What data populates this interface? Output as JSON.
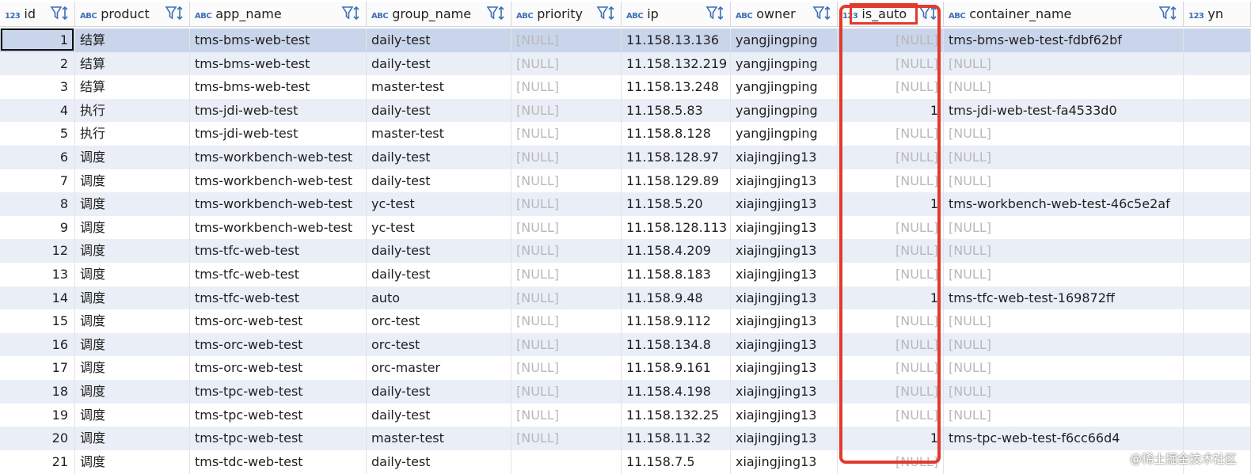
{
  "columns": [
    {
      "type": "123",
      "name": "id"
    },
    {
      "type": "ABC",
      "name": "product"
    },
    {
      "type": "ABC",
      "name": "app_name"
    },
    {
      "type": "ABC",
      "name": "group_name"
    },
    {
      "type": "ABC",
      "name": "priority"
    },
    {
      "type": "ABC",
      "name": "ip"
    },
    {
      "type": "ABC",
      "name": "owner"
    },
    {
      "type": "123",
      "name": "is_auto"
    },
    {
      "type": "ABC",
      "name": "container_name"
    },
    {
      "type": "123",
      "name": "yn"
    }
  ],
  "rows": [
    [
      "1",
      "结算",
      "tms-bms-web-test",
      "daily-test",
      "[NULL]",
      "11.158.13.136",
      "yangjingping",
      "[NULL]",
      "tms-bms-web-test-fdbf62bf"
    ],
    [
      "2",
      "结算",
      "tms-bms-web-test",
      "daily-test",
      "[NULL]",
      "11.158.132.219",
      "yangjingping",
      "[NULL]",
      "[NULL]"
    ],
    [
      "3",
      "结算",
      "tms-bms-web-test",
      "master-test",
      "[NULL]",
      "11.158.13.248",
      "yangjingping",
      "[NULL]",
      "[NULL]"
    ],
    [
      "4",
      "执行",
      "tms-jdi-web-test",
      "daily-test",
      "[NULL]",
      "11.158.5.83",
      "yangjingping",
      "1",
      "tms-jdi-web-test-fa4533d0"
    ],
    [
      "5",
      "执行",
      "tms-jdi-web-test",
      "master-test",
      "[NULL]",
      "11.158.8.128",
      "yangjingping",
      "[NULL]",
      "[NULL]"
    ],
    [
      "6",
      "调度",
      "tms-workbench-web-test",
      "daily-test",
      "[NULL]",
      "11.158.128.97",
      "xiajingjing13",
      "[NULL]",
      "[NULL]"
    ],
    [
      "7",
      "调度",
      "tms-workbench-web-test",
      "daily-test",
      "[NULL]",
      "11.158.129.89",
      "xiajingjing13",
      "[NULL]",
      "[NULL]"
    ],
    [
      "8",
      "调度",
      "tms-workbench-web-test",
      "yc-test",
      "[NULL]",
      "11.158.5.20",
      "xiajingjing13",
      "1",
      "tms-workbench-web-test-46c5e2af"
    ],
    [
      "9",
      "调度",
      "tms-workbench-web-test",
      "yc-test",
      "[NULL]",
      "11.158.128.113",
      "xiajingjing13",
      "[NULL]",
      "[NULL]"
    ],
    [
      "12",
      "调度",
      "tms-tfc-web-test",
      "daily-test",
      "[NULL]",
      "11.158.4.209",
      "xiajingjing13",
      "[NULL]",
      "[NULL]"
    ],
    [
      "13",
      "调度",
      "tms-tfc-web-test",
      "daily-test",
      "[NULL]",
      "11.158.8.183",
      "xiajingjing13",
      "[NULL]",
      "[NULL]"
    ],
    [
      "14",
      "调度",
      "tms-tfc-web-test",
      "auto",
      "[NULL]",
      "11.158.9.48",
      "xiajingjing13",
      "1",
      "tms-tfc-web-test-169872ff"
    ],
    [
      "15",
      "调度",
      "tms-orc-web-test",
      "orc-test",
      "[NULL]",
      "11.158.9.112",
      "xiajingjing13",
      "[NULL]",
      "[NULL]"
    ],
    [
      "16",
      "调度",
      "tms-orc-web-test",
      "orc-test",
      "[NULL]",
      "11.158.134.8",
      "xiajingjing13",
      "[NULL]",
      "[NULL]"
    ],
    [
      "17",
      "调度",
      "tms-orc-web-test",
      "orc-master",
      "[NULL]",
      "11.158.9.161",
      "xiajingjing13",
      "[NULL]",
      "[NULL]"
    ],
    [
      "18",
      "调度",
      "tms-tpc-web-test",
      "daily-test",
      "[NULL]",
      "11.158.4.198",
      "xiajingjing13",
      "[NULL]",
      "[NULL]"
    ],
    [
      "19",
      "调度",
      "tms-tpc-web-test",
      "daily-test",
      "[NULL]",
      "11.158.132.25",
      "xiajingjing13",
      "[NULL]",
      "[NULL]"
    ],
    [
      "20",
      "调度",
      "tms-tpc-web-test",
      "master-test",
      "[NULL]",
      "11.158.11.32",
      "xiajingjing13",
      "1",
      "tms-tpc-web-test-f6cc66d4"
    ],
    [
      "21",
      "调度",
      "tms-tdc-web-test",
      "daily-test",
      "",
      "11.158.7.5",
      "xiajingjing13",
      "[NULL]",
      ""
    ]
  ],
  "selected_row_index": 0,
  "highlight": {
    "column": "is_auto",
    "color": "#e23b2e"
  },
  "watermark": "@稀土掘金技术社区",
  "colors": {
    "header_type_badge": "#3d6fb6",
    "null_text": "#b9b9b9",
    "row_alt": "#e9eef7",
    "row_selected": "#c9d5ea",
    "highlight": "#e23b2e"
  }
}
